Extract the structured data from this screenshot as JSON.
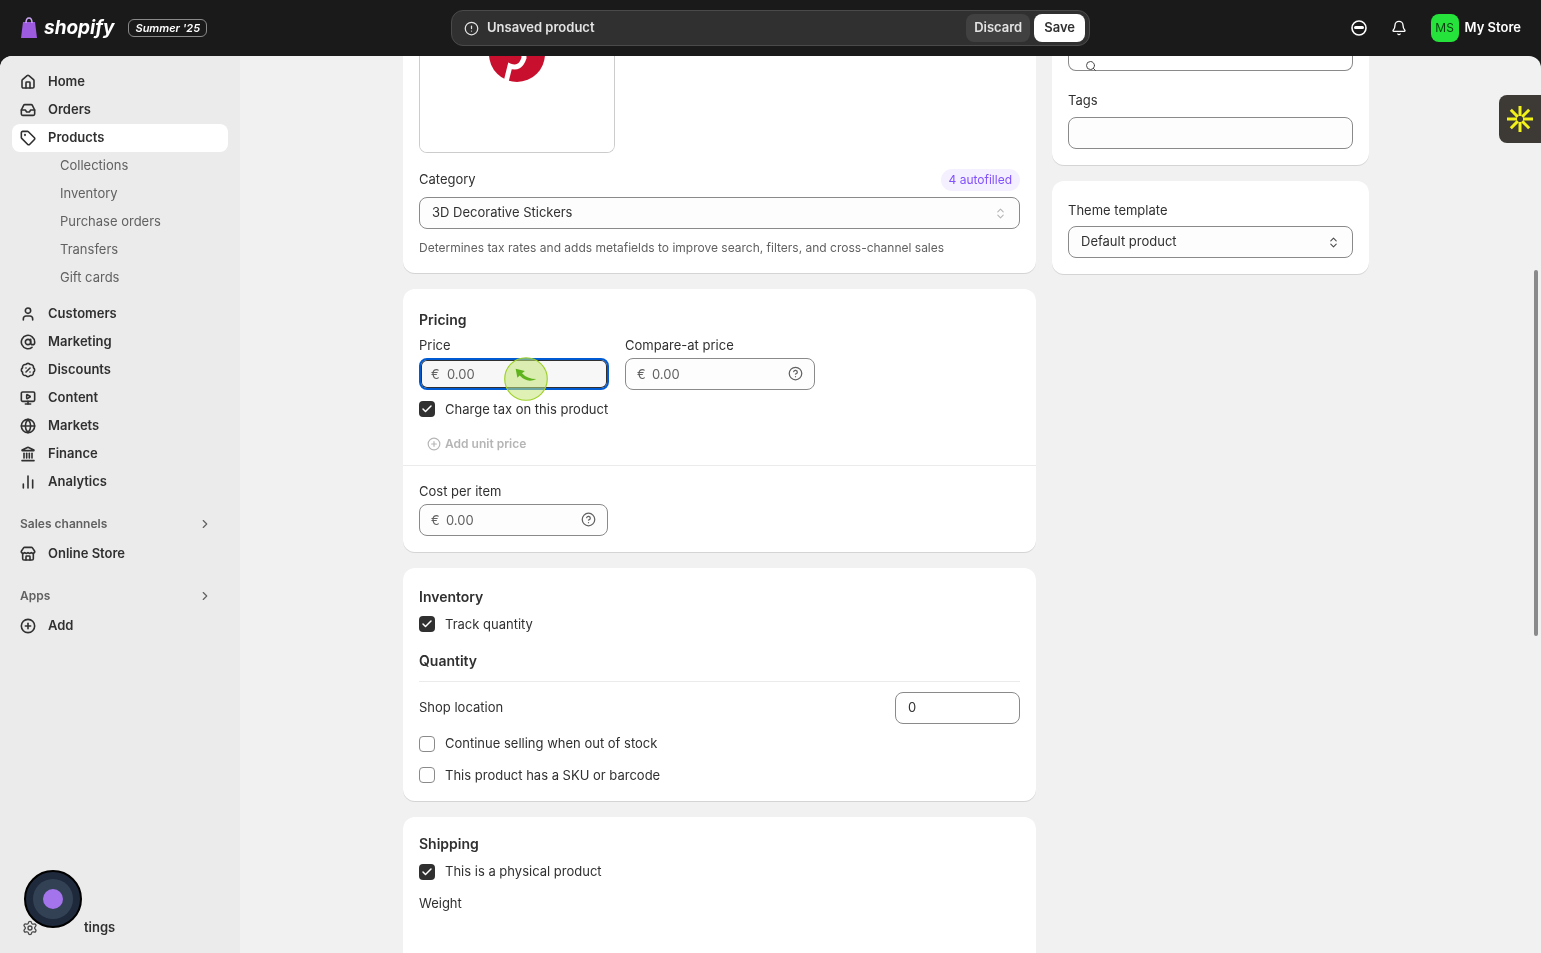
{
  "topbar": {
    "brand": "shopify",
    "edition": "Summer '25",
    "notice": "Unsaved product",
    "actions": [
      {
        "label": "Discard",
        "kind": "secondary"
      },
      {
        "label": "Save",
        "kind": "primary"
      }
    ],
    "avatar": "MS",
    "store": "My Store"
  },
  "sidebar": {
    "items": [
      {
        "label": "Home",
        "kind": "home",
        "selected": false
      },
      {
        "label": "Orders",
        "kind": "orders",
        "selected": false
      },
      {
        "label": "Products",
        "kind": "tag",
        "selected": true,
        "children": [
          {
            "label": "Collections",
            "selected": false
          },
          {
            "label": "Inventory",
            "selected": false
          },
          {
            "label": "Purchase orders",
            "selected": false
          },
          {
            "label": "Transfers",
            "selected": false
          },
          {
            "label": "Gift cards",
            "selected": false
          }
        ]
      },
      {
        "label": "Customers",
        "kind": "user",
        "selected": false
      },
      {
        "label": "Marketing",
        "kind": "marketing",
        "selected": false
      },
      {
        "label": "Discounts",
        "kind": "discount",
        "selected": false
      },
      {
        "label": "Content",
        "kind": "content",
        "selected": false
      },
      {
        "label": "Markets",
        "kind": "globe",
        "selected": false
      },
      {
        "label": "Finance",
        "kind": "finance",
        "selected": false
      },
      {
        "label": "Analytics",
        "kind": "chart",
        "selected": false
      }
    ],
    "sections": [
      {
        "title": "Sales channels",
        "items": [
          {
            "label": "Online Store",
            "kind": "store",
            "selected": false
          }
        ]
      },
      {
        "title": "Apps",
        "items": [
          {
            "label": "Add",
            "kind": "add",
            "selected": false
          }
        ]
      }
    ],
    "settings": "tings"
  },
  "category": {
    "label": "Category",
    "badge": "4 autofilled",
    "value": "3D Decorative Stickers",
    "help": "Determines tax rates and adds metafields to improve search, filters, and cross-channel sales"
  },
  "pricing": {
    "title": "Pricing",
    "fields": [
      {
        "label": "Price",
        "prefix": "€",
        "placeholder": "0.00",
        "focused": true,
        "help_icon": false
      },
      {
        "label": "Compare-at price",
        "prefix": "€",
        "placeholder": "0.00",
        "focused": false,
        "help_icon": true
      }
    ],
    "charge_tax": {
      "label": "Charge tax on this product",
      "checked": true
    },
    "add_unit_price": {
      "label": "Add unit price",
      "disabled": true
    },
    "cost": {
      "label": "Cost per item",
      "prefix": "€",
      "placeholder": "0.00",
      "focused": false,
      "help_icon": true
    }
  },
  "inventory": {
    "title": "Inventory",
    "track": {
      "label": "Track quantity",
      "checked": true
    },
    "quantity_title": "Quantity",
    "location": {
      "label": "Shop location",
      "value": "0"
    },
    "options": [
      {
        "label": "Continue selling when out of stock",
        "checked": false
      },
      {
        "label": "This product has a SKU or barcode",
        "checked": false
      }
    ]
  },
  "shipping": {
    "title": "Shipping",
    "physical": {
      "label": "This is a physical product",
      "checked": true
    },
    "weight_label": "Weight"
  },
  "organization": {
    "tags_label": "Tags"
  },
  "theme": {
    "label": "Theme template",
    "value": "Default product"
  }
}
